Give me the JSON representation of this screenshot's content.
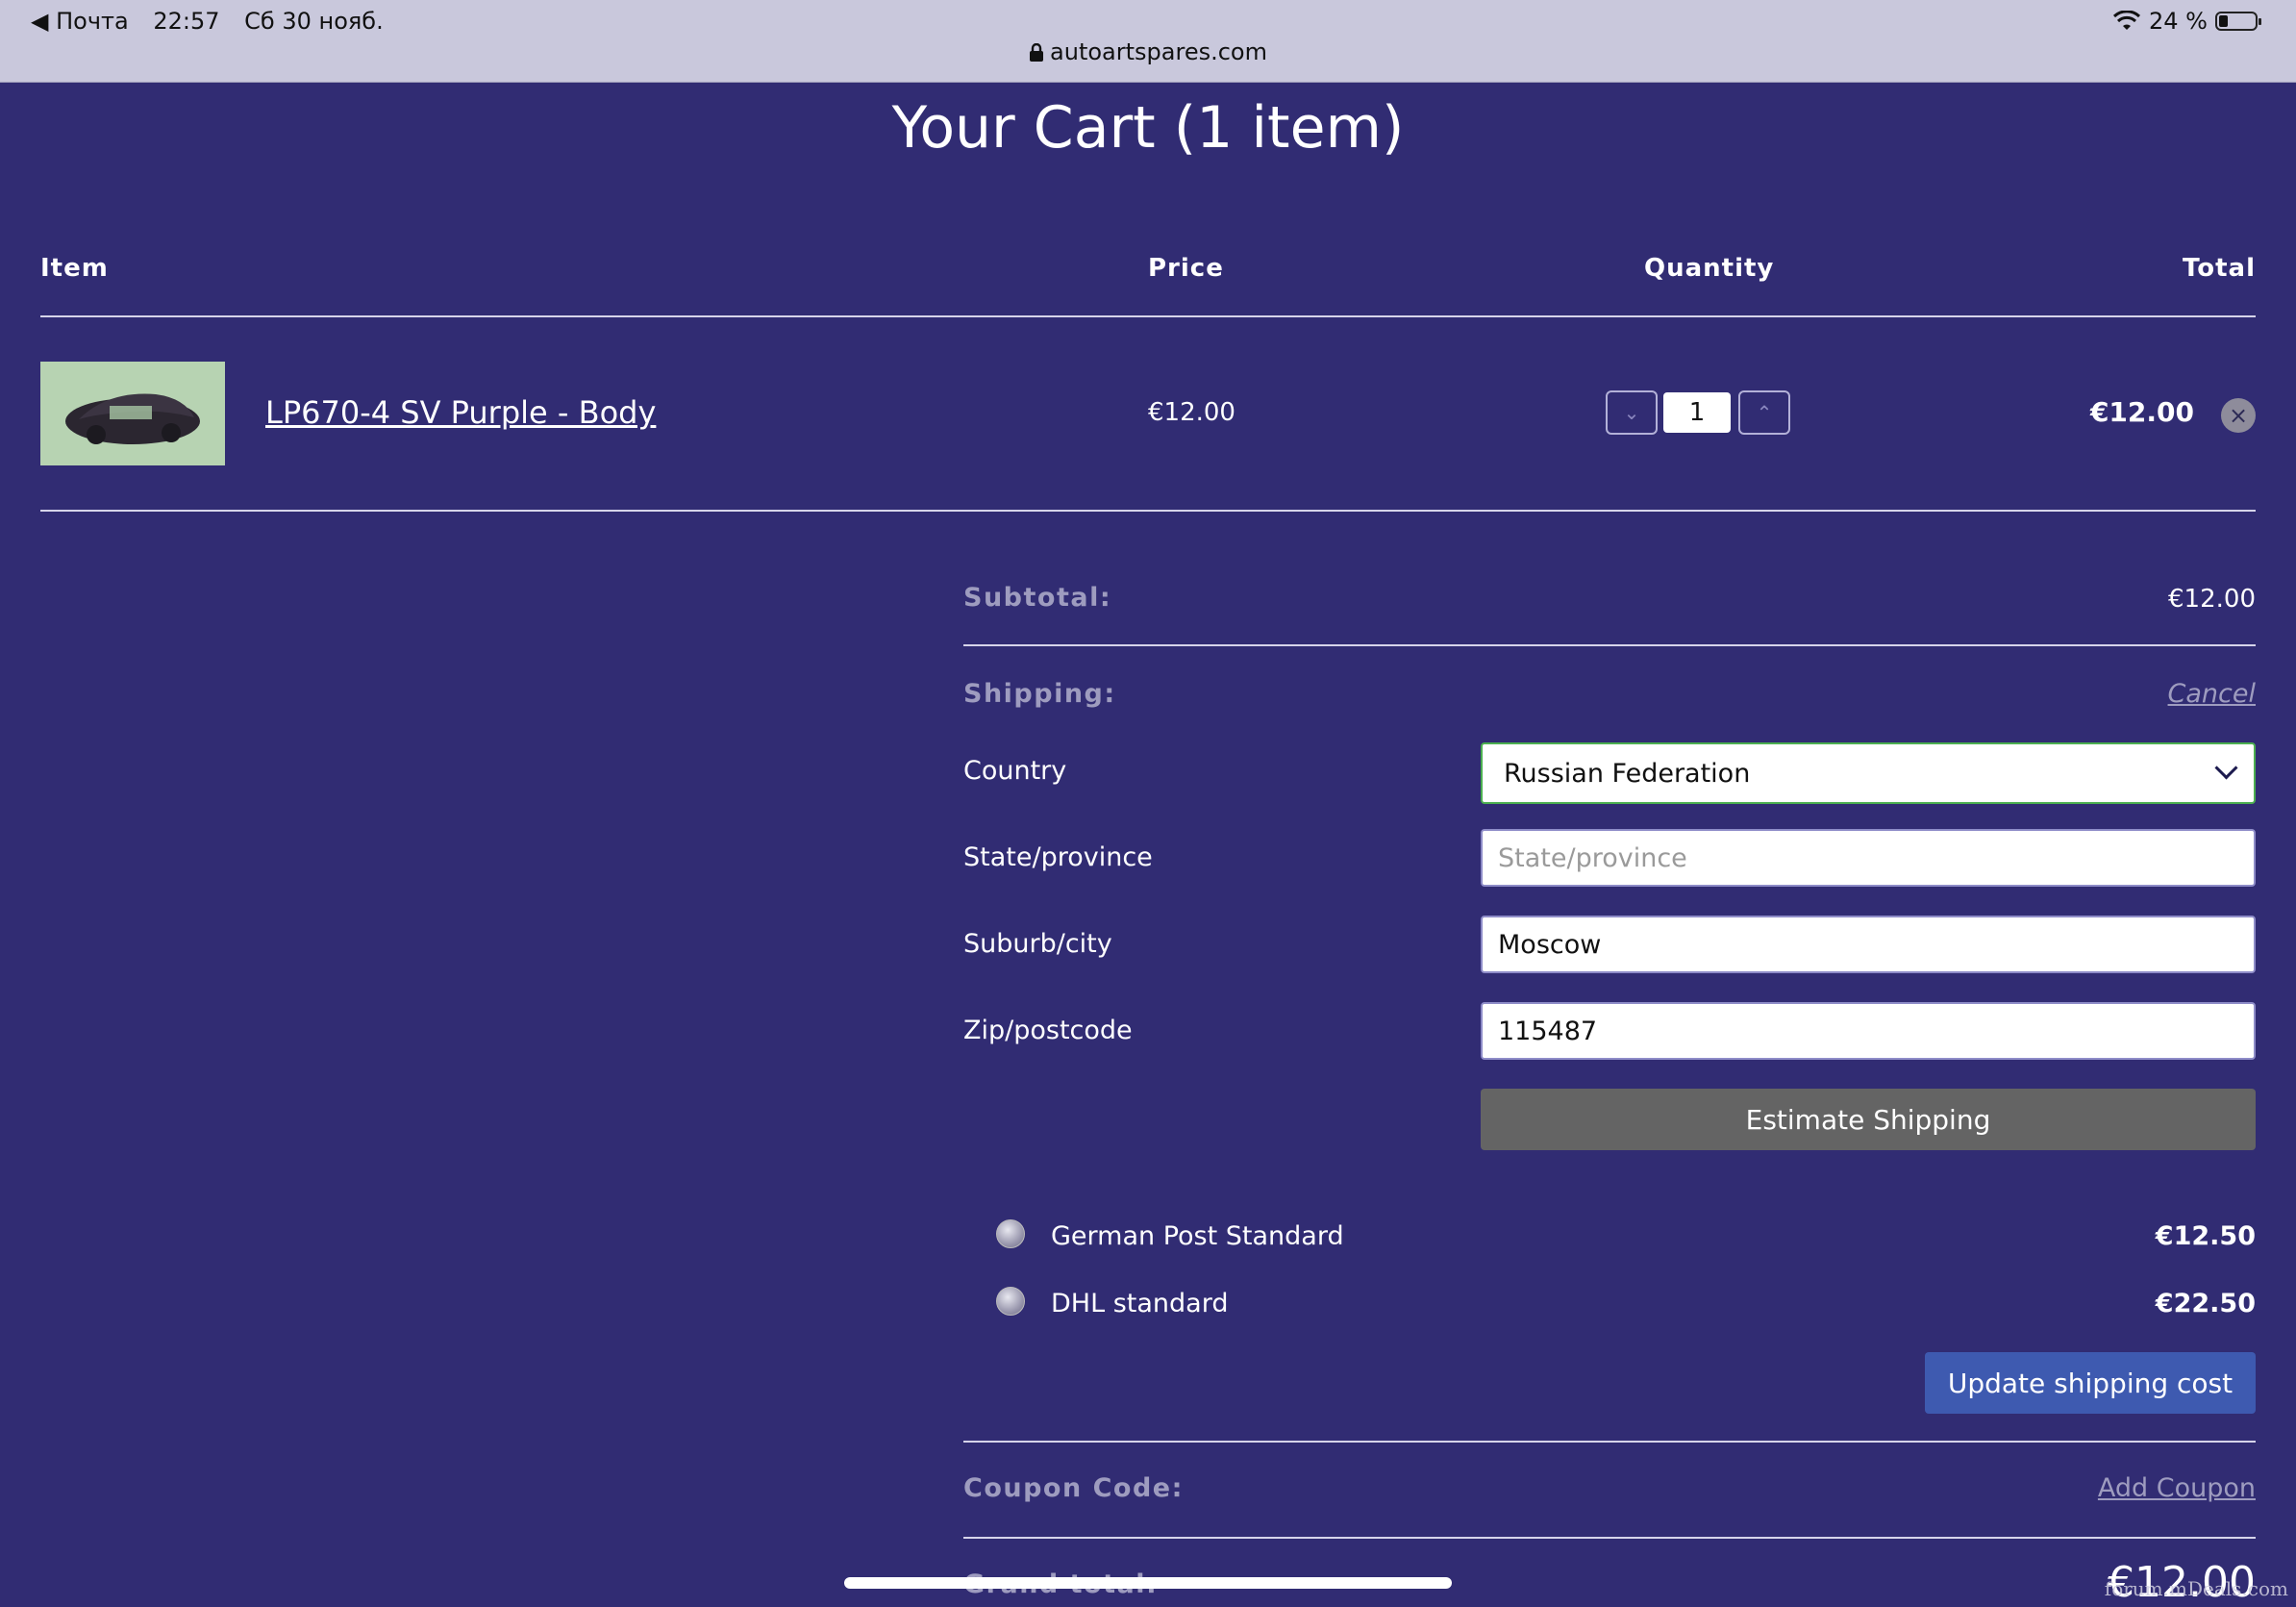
{
  "status_bar": {
    "back_app": "◀ Почта",
    "time": "22:57",
    "date": "Сб 30 нояб.",
    "battery": "24 %",
    "battery_level": 0.24,
    "url": "autoartspares.com"
  },
  "page_title": "Your Cart (1 item)",
  "table_headers": {
    "item": "Item",
    "price": "Price",
    "quantity": "Quantity",
    "total": "Total"
  },
  "cart_item": {
    "name": "LP670-4 SV Purple - Body",
    "price": "€12.00",
    "quantity": "1",
    "total": "€12.00",
    "remove_icon": "×",
    "decrement_icon": "⌄",
    "increment_icon": "⌃"
  },
  "summary": {
    "subtotal_label": "Subtotal:",
    "subtotal_value": "€12.00",
    "shipping_label": "Shipping:",
    "cancel_label": "Cancel"
  },
  "shipping_form": {
    "country_label": "Country",
    "country_value": "Russian Federation",
    "state_label": "State/province",
    "state_placeholder": "State/province",
    "city_label": "Suburb/city",
    "city_value": "Moscow",
    "zip_label": "Zip/postcode",
    "zip_value": "115487",
    "estimate_button": "Estimate Shipping"
  },
  "shipping_options": [
    {
      "name": "German Post Standard",
      "price": "€12.50"
    },
    {
      "name": "DHL standard",
      "price": "€22.50"
    }
  ],
  "update_button": "Update shipping cost",
  "coupon": {
    "label": "Coupon Code:",
    "link": "Add Coupon"
  },
  "grand_total": {
    "label": "Grand total:",
    "value": "€12.00"
  },
  "watermark": "forum.mDeals.com",
  "colors": {
    "background": "#312c73",
    "update_button": "#3e5ab0",
    "estimate_button": "#646464"
  }
}
